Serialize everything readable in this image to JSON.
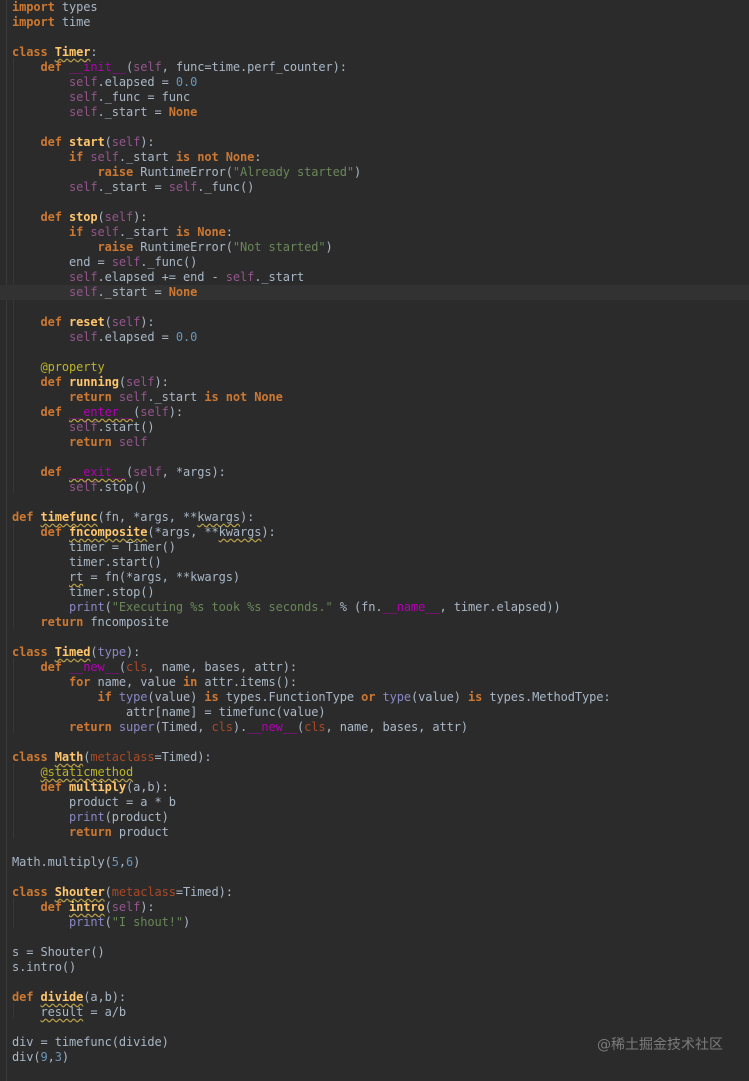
{
  "editor": {
    "language": "python",
    "theme": "darcula",
    "current_line_index": 19,
    "lines": [
      "import types",
      "import time",
      "",
      "class Timer:",
      "    def __init__(self, func=time.perf_counter):",
      "        self.elapsed = 0.0",
      "        self._func = func",
      "        self._start = None",
      "",
      "    def start(self):",
      "        if self._start is not None:",
      "            raise RuntimeError(\"Already started\")",
      "        self._start = self._func()",
      "",
      "    def stop(self):",
      "        if self._start is None:",
      "            raise RuntimeError(\"Not started\")",
      "        end = self._func()",
      "        self.elapsed += end - self._start",
      "        self._start = None",
      "",
      "    def reset(self):",
      "        self.elapsed = 0.0",
      "",
      "    @property",
      "    def running(self):",
      "        return self._start is not None",
      "    def __enter__(self):",
      "        self.start()",
      "        return self",
      "",
      "    def __exit__(self, *args):",
      "        self.stop()",
      "",
      "def timefunc(fn, *args, **kwargs):",
      "    def fncomposite(*args, **kwargs):",
      "        timer = Timer()",
      "        timer.start()",
      "        rt = fn(*args, **kwargs)",
      "        timer.stop()",
      "        print(\"Executing %s took %s seconds.\" % (fn.__name__, timer.elapsed))",
      "    return fncomposite",
      "",
      "class Timed(type):",
      "    def __new__(cls, name, bases, attr):",
      "        for name, value in attr.items():",
      "            if type(value) is types.FunctionType or type(value) is types.MethodType:",
      "                attr[name] = timefunc(value)",
      "        return super(Timed, cls).__new__(cls, name, bases, attr)",
      "",
      "class Math(metaclass=Timed):",
      "    @staticmethod",
      "    def multiply(a,b):",
      "        product = a * b",
      "        print(product)",
      "        return product",
      "",
      "Math.multiply(5,6)",
      "",
      "class Shouter(metaclass=Timed):",
      "    def intro(self):",
      "        print(\"I shout!\")",
      "",
      "s = Shouter()",
      "s.intro()",
      "",
      "def divide(a,b):",
      "    result = a/b",
      "",
      "div = timefunc(divide)",
      "div(9,3)"
    ]
  },
  "watermark": {
    "text": "@稀土掘金技术社区"
  },
  "colors": {
    "background": "#2b2b2b",
    "current_line": "#323232",
    "keyword": "#cc7832",
    "self": "#94558d",
    "number": "#6897bb",
    "string": "#6a8759",
    "function_name": "#ffc66d",
    "magic_method": "#b200b2",
    "decorator": "#bbb529",
    "builtin": "#8888c6",
    "default_text": "#a9b7c6"
  }
}
